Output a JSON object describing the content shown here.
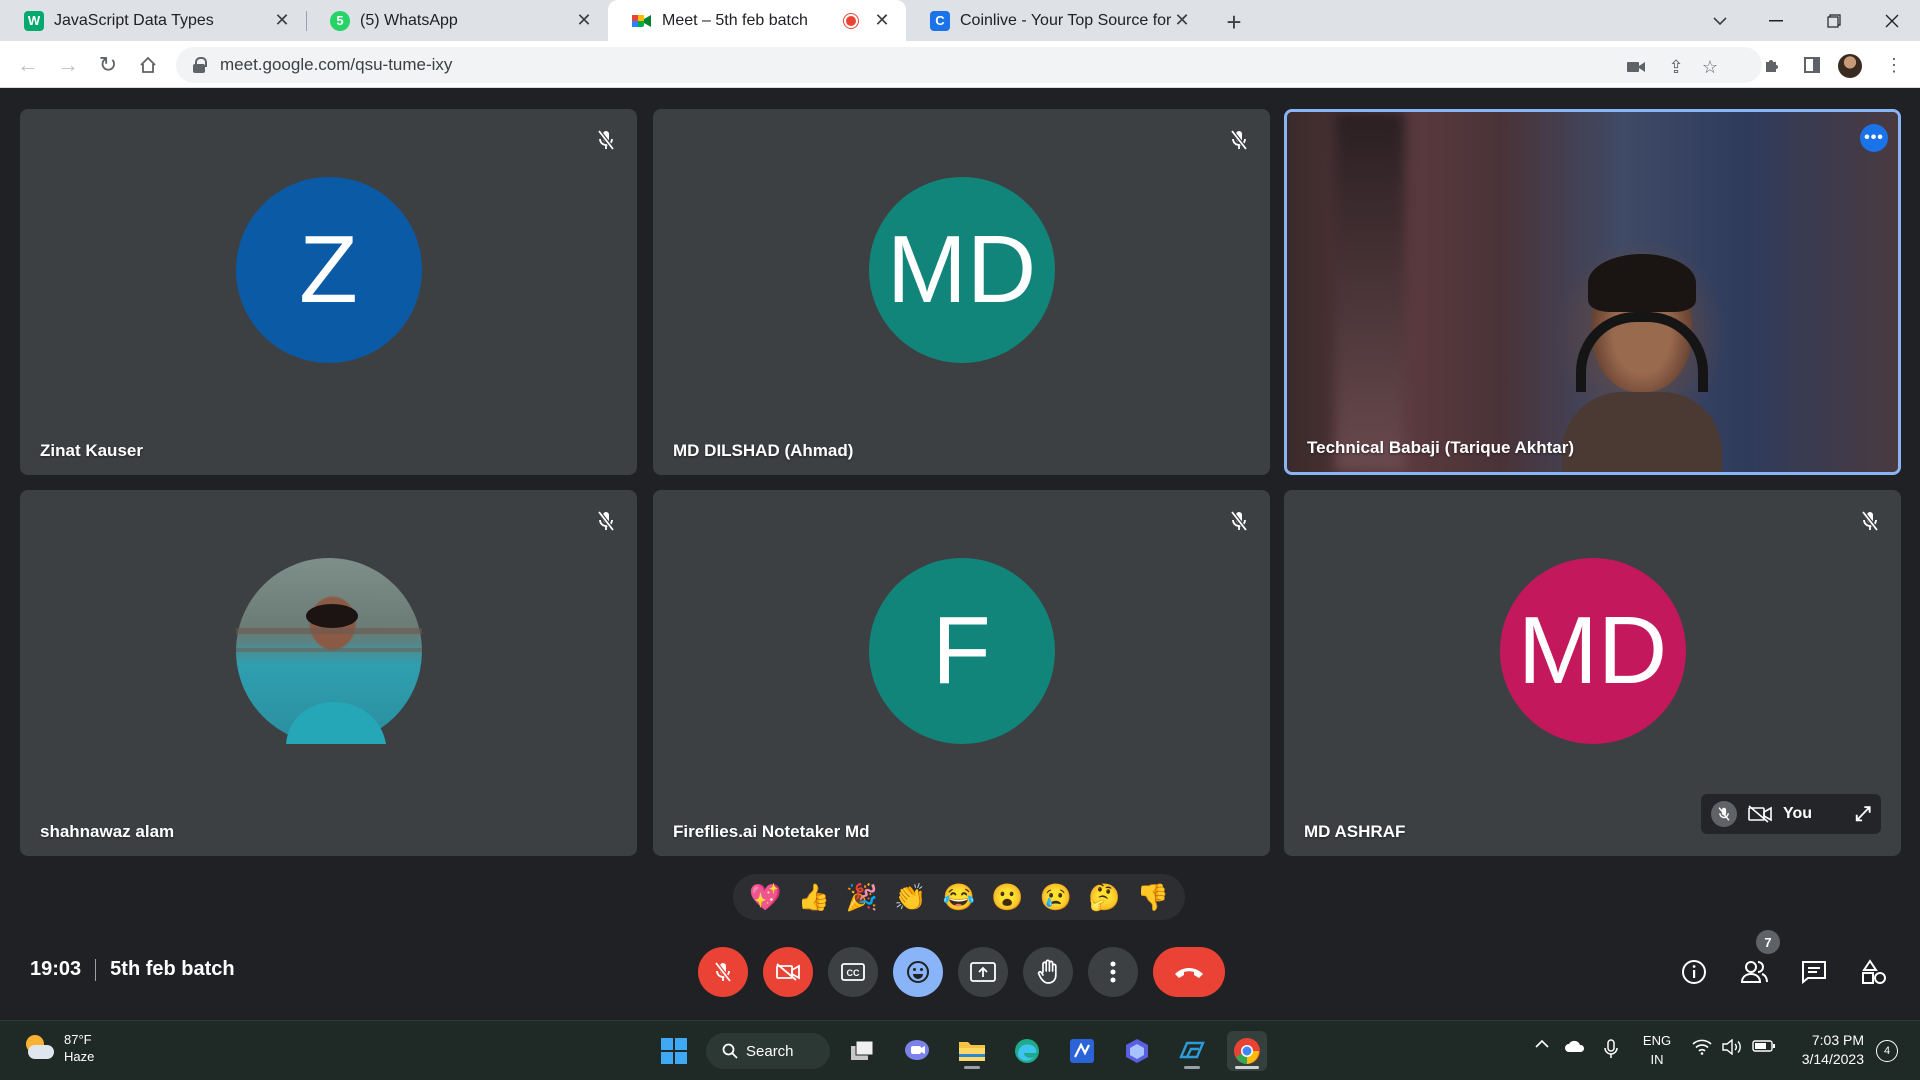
{
  "browser": {
    "tabs": [
      {
        "title": "JavaScript Data Types",
        "favicon": "w3schools-icon",
        "active": false
      },
      {
        "title": "(5) WhatsApp",
        "favicon": "whatsapp-icon",
        "active": false
      },
      {
        "title": "Meet – 5th feb batch",
        "favicon": "google-meet-icon",
        "active": true,
        "recording": true
      },
      {
        "title": "Coinlive - Your Top Source for All",
        "favicon": "coinlive-icon",
        "active": false
      }
    ],
    "url": "meet.google.com/qsu-tume-ixy"
  },
  "participants": [
    {
      "name": "Zinat Kauser",
      "initial": "Z",
      "color": "#0b5aa6",
      "muted": true,
      "type": "initial"
    },
    {
      "name": "MD DILSHAD (Ahmad)",
      "initial": "MD",
      "color": "#12857a",
      "muted": true,
      "type": "initial"
    },
    {
      "name": "Technical Babaji (Tarique Akhtar)",
      "initial": "",
      "color": "",
      "muted": false,
      "type": "video",
      "speaking": true
    },
    {
      "name": "shahnawaz alam",
      "initial": "",
      "color": "",
      "muted": true,
      "type": "photo"
    },
    {
      "name": "Fireflies.ai Notetaker Md",
      "initial": "F",
      "color": "#12857a",
      "muted": true,
      "type": "initial"
    },
    {
      "name": "MD ASHRAF",
      "initial": "MD",
      "color": "#c4185c",
      "muted": true,
      "type": "initial"
    }
  ],
  "self_view": {
    "label": "You"
  },
  "reactions": [
    "💖",
    "👍",
    "🎉",
    "👏",
    "😂",
    "😮",
    "😢",
    "🤔",
    "👎"
  ],
  "meeting": {
    "time": "19:03",
    "name": "5th feb batch",
    "people_count": "7"
  },
  "colors": {
    "accent": "#8ab4f8",
    "danger": "#ea4335",
    "tile": "#3c4043",
    "background": "#202124"
  },
  "taskbar": {
    "weather_temp": "87°F",
    "weather_desc": "Haze",
    "search_label": "Search",
    "lang_line1": "ENG",
    "lang_line2": "IN",
    "time": "7:03 PM",
    "date": "3/14/2023",
    "notification_count": "4"
  }
}
